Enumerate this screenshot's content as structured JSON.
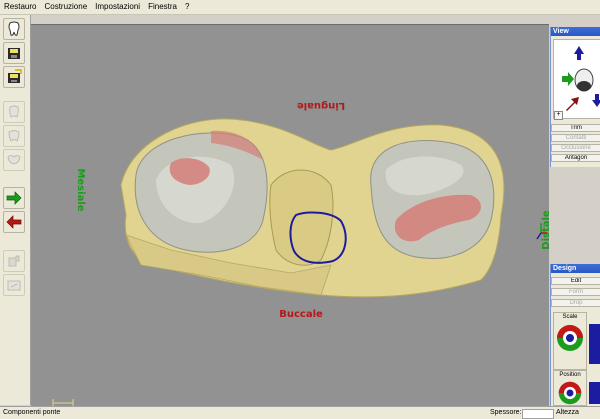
{
  "menu": [
    "Restauro",
    "Costruzione",
    "Impostazioni",
    "Finestra",
    "?"
  ],
  "toolbar_icons": [
    "tooth-icon",
    "save-icon",
    "save-as-icon",
    "tooth-disabled-icon",
    "tooth-disabled-icon",
    "tooth-disabled-icon",
    "next-arrow-icon",
    "back-arrow-icon",
    "tool-disabled-icon",
    "tool-disabled-icon"
  ],
  "viewport": {
    "labels": {
      "linguale": "Linguale",
      "mesiale": "Mesiale",
      "distale": "Distale",
      "buccale": "Buccale"
    },
    "colors": {
      "background": "#929292",
      "model": "#e0d490",
      "crown": "#c4c6bc",
      "contact": "#d47e78",
      "outline": "#1c1ca0",
      "label_red": "#b41818",
      "label_green": "#1c9c1c"
    }
  },
  "view_panel": {
    "title": "View",
    "buttons": [
      "Trim",
      "Contatti",
      "Occlusione",
      "Antagon"
    ]
  },
  "design_panel": {
    "title": "Design",
    "buttons": [
      "Edit",
      "Form",
      "Drop"
    ],
    "sections": [
      "Scale",
      "Position"
    ]
  },
  "status": {
    "left": "Componenti ponte",
    "spessore": "Spessore:",
    "altezza": "Altezza"
  }
}
